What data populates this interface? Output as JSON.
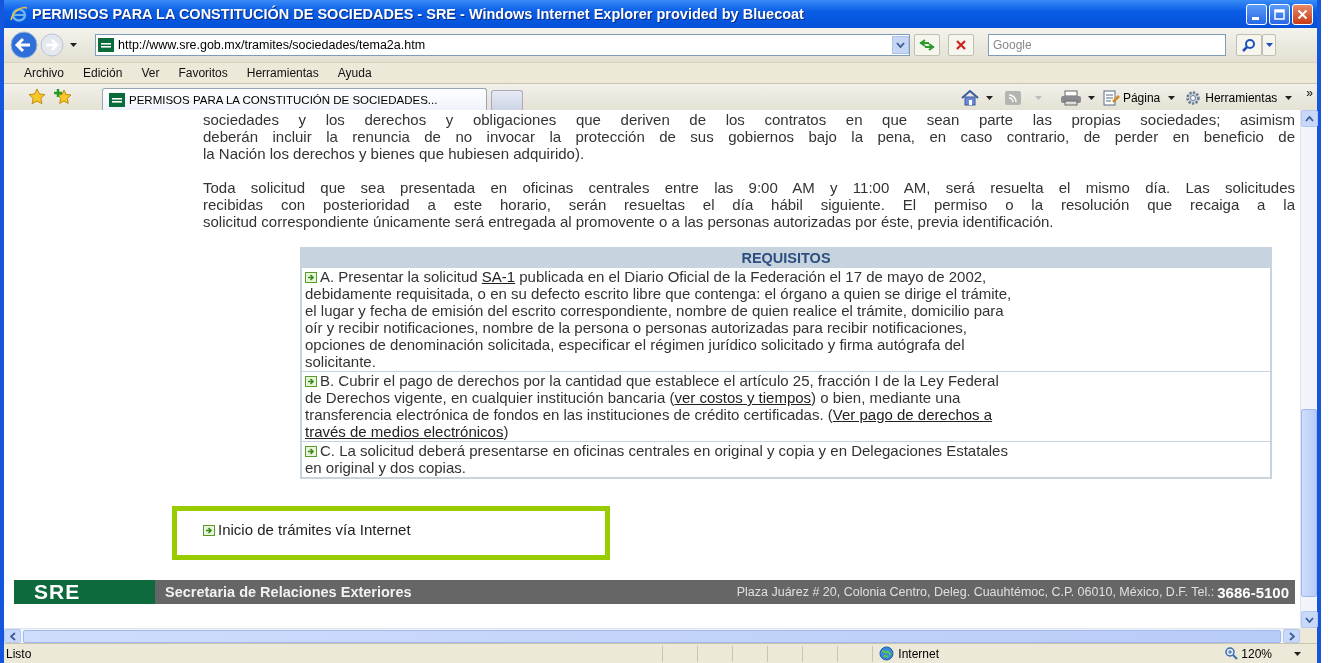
{
  "window": {
    "title": "PERMISOS PARA LA CONSTITUCIÓN DE SOCIEDADES - SRE - Windows Internet Explorer provided by Bluecoat"
  },
  "address_bar": {
    "url": "http://www.sre.gob.mx/tramites/sociedades/tema2a.htm",
    "search_placeholder": "Google"
  },
  "menu": [
    "Archivo",
    "Edición",
    "Ver",
    "Favoritos",
    "Herramientas",
    "Ayuda"
  ],
  "tabs": [
    {
      "label": "PERMISOS PARA LA CONSTITUCIÓN DE SOCIEDADES...",
      "selected": true
    }
  ],
  "command_bar": {
    "items": [
      "Página",
      "Herramientas"
    ],
    "overflow": "»"
  },
  "page": {
    "paragraphs": [
      [
        "sociedades y los derechos y obligaciones que deriven de los contratos en que sean parte las propias sociedades; asimism",
        "deberán incluir la renuncia de no invocar la protección de sus gobiernos bajo la pena, en caso contrario, de perder en beneficio de",
        "la Nación los derechos y bienes que hubiesen adquirido)."
      ],
      [
        "Toda solicitud que sea presentada en oficinas centrales entre las 9:00 AM y 11:00 AM,  será resuelta el mismo día. Las solicitudes",
        "recibidas con posterioridad a este horario, serán resueltas el día hábil siguiente. El permiso o la resolución que recaiga a la",
        "solicitud correspondiente únicamente será entregada al promovente o a las personas autorizadas por éste, previa identificación."
      ]
    ],
    "requirements": {
      "title": "REQUISITOS",
      "items": [
        {
          "lines": [
            [
              {
                "text": "A.  Presentar la solicitud "
              },
              {
                "link": "SA-1"
              },
              {
                "text": " publicada en el Diario Oficial de la Federación el 17 de mayo de 2002,"
              }
            ],
            [
              {
                "text": "debidamente requisitada, o en su defecto escrito libre que contenga: el órgano a quien se dirige el trámite,"
              }
            ],
            [
              {
                "text": "el lugar y fecha de emisión del escrito correspondiente, nombre de quien realice el trámite, domicilio para"
              }
            ],
            [
              {
                "text": "oír y recibir notificaciones, nombre de la persona o personas autorizadas para recibir notificaciones,"
              }
            ],
            [
              {
                "text": "opciones de denominación solicitada, especificar el régimen jurídico solicitado y firma autógrafa del"
              }
            ],
            [
              {
                "text": "solicitante."
              }
            ]
          ]
        },
        {
          "lines": [
            [
              {
                "text": "B.  Cubrir el pago de derechos por la cantidad que establece el artículo 25, fracción I de la Ley Federal"
              }
            ],
            [
              {
                "text": "de Derechos vigente, en cualquier institución bancaria ("
              },
              {
                "link": "ver costos y tiempos"
              },
              {
                "text": ") o bien, mediante una"
              }
            ],
            [
              {
                "text": "transferencia electrónica de fondos en las instituciones de crédito certificadas. ("
              },
              {
                "link": "Ver pago de derechos a"
              }
            ],
            [
              {
                "link": "través de medios electrónicos"
              },
              {
                "text": ")"
              }
            ]
          ]
        },
        {
          "lines": [
            [
              {
                "text": "C.  La solicitud deberá presentarse en oficinas centrales en original y copia y en Delegaciones Estatales"
              }
            ],
            [
              {
                "text": "en original y dos copias."
              }
            ]
          ]
        }
      ]
    },
    "internet_link": "Inicio de trámites vía Internet"
  },
  "footer": {
    "logo": "SRE",
    "name": "Secretaria de Relaciones Exteriores",
    "address": "Plaza Juárez # 20, Colonia Centro, Deleg. Cuauhtémoc, C.P. 06010, México, D.F. Tel.:",
    "phone": "3686-5100"
  },
  "status_bar": {
    "text": "Listo",
    "zone": "Internet",
    "zoom": "120%"
  }
}
